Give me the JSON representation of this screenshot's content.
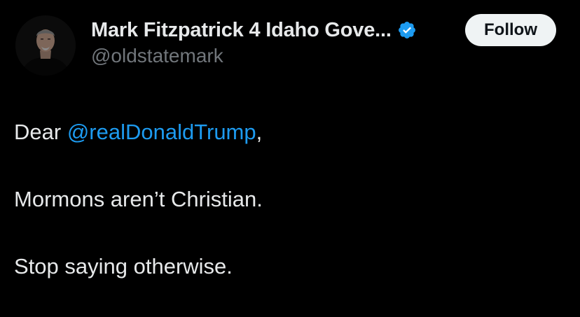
{
  "author": {
    "display_name": "Mark Fitzpatrick 4 Idaho Gove...",
    "handle": "@oldstatemark",
    "verified_icon": "verified-badge-icon",
    "avatar": "author-avatar"
  },
  "follow_button": {
    "label": "Follow"
  },
  "tweet": {
    "line1_prefix": "Dear ",
    "mention": "@realDonaldTrump",
    "line1_suffix": ",",
    "line2": "Mormons aren’t Christian.",
    "line3": "Stop saying otherwise."
  },
  "colors": {
    "background": "#000000",
    "text": "#e7e9ea",
    "secondary_text": "#71767b",
    "link": "#1d9bf0",
    "verified": "#1d9bf0",
    "follow_bg": "#eff3f4"
  }
}
